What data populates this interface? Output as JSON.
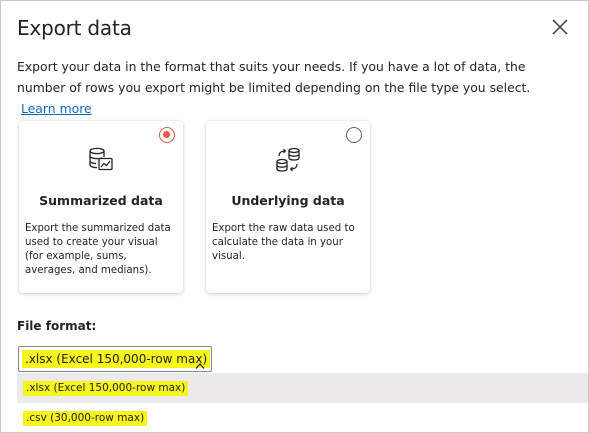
{
  "dialog": {
    "title": "Export data",
    "description": "Export your data in the format that suits your needs. If you have a lot of data, the number of rows you export might be limited depending on the file type you select.",
    "learn_more": "Learn more"
  },
  "options": [
    {
      "title": "Summarized data",
      "description": "Export the summarized data used to create your visual (for example, sums, averages, and medians).",
      "selected": true,
      "icon": "database-chart-icon"
    },
    {
      "title": "Underlying data",
      "description": "Export the raw data used to calculate the data in your visual.",
      "selected": false,
      "icon": "database-sync-icon"
    }
  ],
  "file_format": {
    "label": "File format:",
    "selected": ".xlsx (Excel 150,000-row max)",
    "options": [
      ".xlsx (Excel 150,000-row max)",
      ".csv (30,000-row max)"
    ]
  },
  "colors": {
    "accent": "#e45c3a",
    "link": "#0f6cbd",
    "highlight": "#f7f51e"
  }
}
